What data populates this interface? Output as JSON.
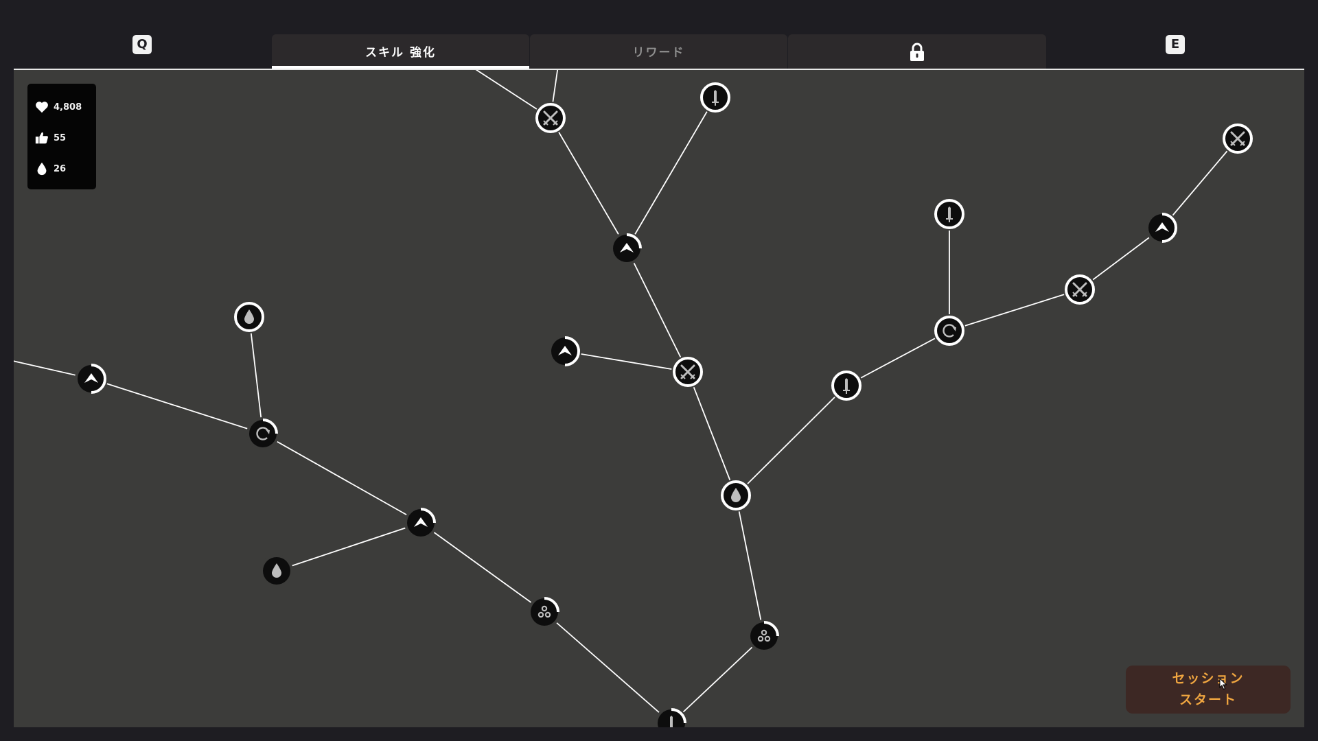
{
  "header": {
    "prev_key": "Q",
    "next_key": "E",
    "tabs": [
      {
        "label": "スキル 強化",
        "active": true
      },
      {
        "label": "リワード",
        "active": false
      },
      {
        "label": "",
        "icon": "lock-icon",
        "locked": true
      }
    ]
  },
  "stats": {
    "hearts": "4,808",
    "likes": "55",
    "drops": "26"
  },
  "start_button": {
    "line1": "セッション",
    "line2": "スタート"
  },
  "colors": {
    "background": "#1e1d22",
    "panel": "#3c3c3a",
    "node_fill": "#0d0d0d",
    "highlight": "#ffffff",
    "button_bg": "#3d2824",
    "button_text": "#f0a640"
  },
  "skill_tree": {
    "nodes": [
      {
        "id": "n1",
        "icon": "crossed-swords-icon",
        "progress": 1
      },
      {
        "id": "n2",
        "icon": "sword-icon",
        "progress": 1
      },
      {
        "id": "n3",
        "icon": "chevron-up-icon",
        "progress": 0.25
      },
      {
        "id": "n4",
        "icon": "crossed-swords-icon",
        "progress": 1
      },
      {
        "id": "n5",
        "icon": "chevron-up-icon",
        "progress": 0.5
      },
      {
        "id": "n6",
        "icon": "drop-icon",
        "progress": 1
      },
      {
        "id": "n7",
        "icon": "sword-icon",
        "progress": 1
      },
      {
        "id": "n8",
        "icon": "sword-icon",
        "progress": 1
      },
      {
        "id": "n9",
        "icon": "refresh-icon",
        "progress": 1
      },
      {
        "id": "n10",
        "icon": "crossed-swords-icon",
        "progress": 1
      },
      {
        "id": "n11",
        "icon": "chevron-up-icon",
        "progress": 0.5
      },
      {
        "id": "n12",
        "icon": "crossed-swords-icon",
        "progress": 1
      },
      {
        "id": "n13",
        "icon": "chevron-up-icon",
        "progress": 0.5
      },
      {
        "id": "n14",
        "icon": "drop-icon",
        "progress": 1
      },
      {
        "id": "n15",
        "icon": "refresh-icon",
        "progress": 0.25
      },
      {
        "id": "n16",
        "icon": "chevron-up-icon",
        "progress": 0.25
      },
      {
        "id": "n17",
        "icon": "drop-icon",
        "progress": 0
      },
      {
        "id": "n18",
        "icon": "cluster-icon",
        "progress": 0.25
      },
      {
        "id": "n19",
        "icon": "cluster-icon",
        "progress": 0.25
      },
      {
        "id": "n20",
        "icon": "sword-icon",
        "progress": 0.25
      }
    ],
    "edges": [
      [
        "n0a",
        "n1"
      ],
      [
        "n0b",
        "n1"
      ],
      [
        "n1",
        "n3"
      ],
      [
        "n2",
        "n3"
      ],
      [
        "n3",
        "n4"
      ],
      [
        "n5",
        "n4"
      ],
      [
        "n4",
        "n6"
      ],
      [
        "n6",
        "n7"
      ],
      [
        "n7",
        "n9"
      ],
      [
        "n8",
        "n9"
      ],
      [
        "n9",
        "n10"
      ],
      [
        "n10",
        "n11"
      ],
      [
        "n11",
        "n12"
      ],
      [
        "n6",
        "n19"
      ],
      [
        "n19",
        "n20"
      ],
      [
        "n0c",
        "n13"
      ],
      [
        "n13",
        "n15"
      ],
      [
        "n14",
        "n15"
      ],
      [
        "n15",
        "n16"
      ],
      [
        "n17",
        "n16"
      ],
      [
        "n16",
        "n18"
      ],
      [
        "n18",
        "n20"
      ]
    ]
  }
}
